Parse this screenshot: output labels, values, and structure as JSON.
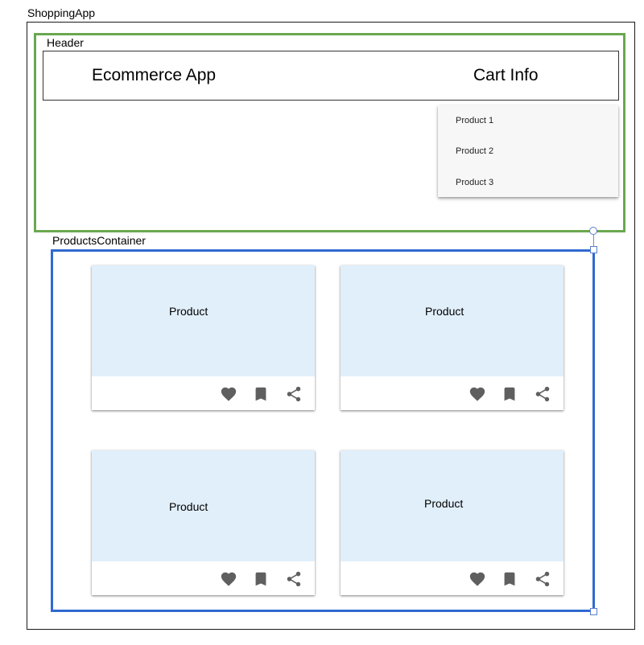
{
  "app": {
    "label": "ShoppingApp"
  },
  "header": {
    "label": "Header",
    "title": "Ecommerce App",
    "cart_label": "Cart Info",
    "cart_items": [
      "Product 1",
      "Product 2",
      "Product 3"
    ]
  },
  "products_container": {
    "label": "ProductsContainer",
    "cards": [
      {
        "title": "Product"
      },
      {
        "title": "Product"
      },
      {
        "title": "Product"
      },
      {
        "title": "Product"
      }
    ],
    "card_actions": [
      "heart-icon",
      "bookmark-icon",
      "share-icon"
    ]
  },
  "colors": {
    "header_border": "#6aa84f",
    "products_border": "#2f6ad0",
    "card_media": "#e1effb",
    "icon": "#5f5f5f"
  }
}
